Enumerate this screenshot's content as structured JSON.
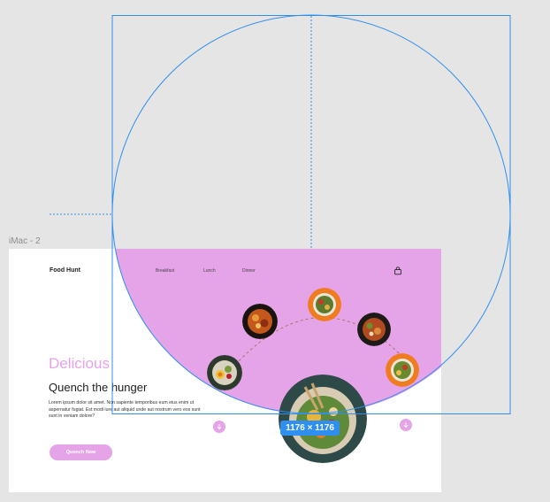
{
  "frame": {
    "label": "iMac - 2"
  },
  "page": {
    "brand": "Food Hunt",
    "nav": [
      {
        "label": "Breakfast"
      },
      {
        "label": "Lunch"
      },
      {
        "label": "Dinner"
      }
    ],
    "hero": {
      "accent_title": "Delicious",
      "title": "Quench the hunger",
      "body": "Lorem ipsum dolor sit amet. Non sapiente temporibus eum eius enim ut aspernatur fugiat. Est modi iure aut aliquid unde aut nostrum vero eos sunt sunt in veniam dolore?",
      "cta_label": "Quench Now"
    }
  },
  "selection": {
    "size_label": "1176 × 1176"
  },
  "colors": {
    "accent": "#e5a3e8",
    "selection": "#2f8ff0",
    "canvas": "#e5e5e5"
  }
}
